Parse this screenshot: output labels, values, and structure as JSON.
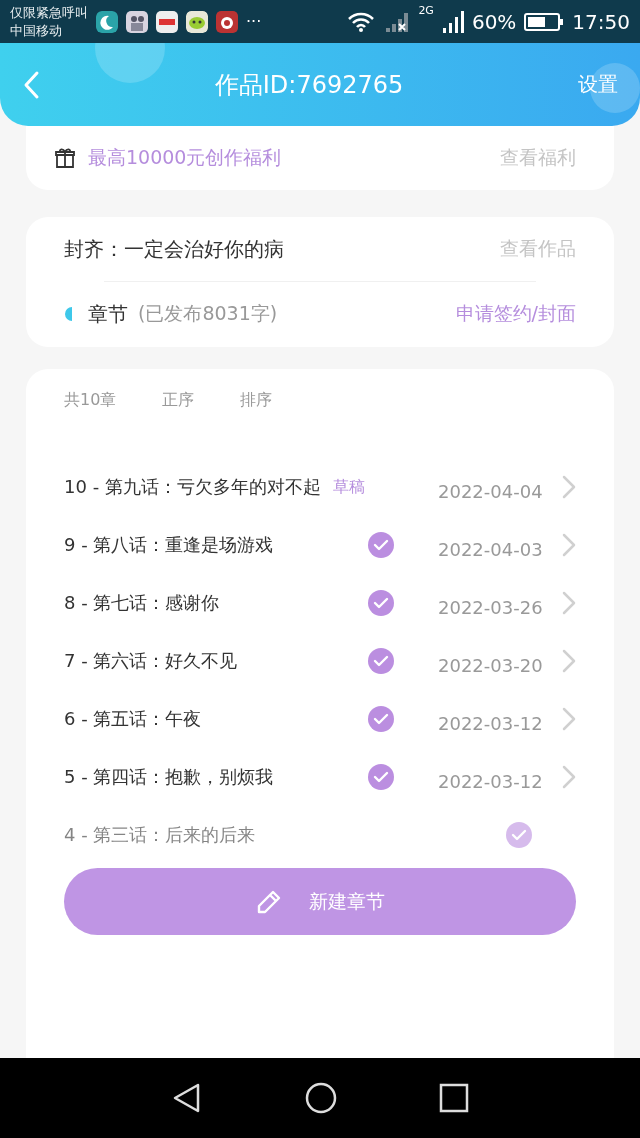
{
  "status_bar": {
    "carrier_notice": "仅限紧急呼叫",
    "carrier": "中国移动",
    "more": "···",
    "network": "2G",
    "battery": "60%",
    "time": "17:50"
  },
  "header": {
    "title": "作品ID:7692765",
    "action": "设置"
  },
  "benefit": {
    "text": "最高10000元创作福利",
    "link": "查看福利"
  },
  "work": {
    "title": "封齐：一定会治好你的病",
    "view": "查看作品",
    "section": "章节",
    "published": "(已发布8031字)",
    "apply": "申请签约/封面"
  },
  "chapters": {
    "count": "共10章",
    "tabs": [
      {
        "label": "正序",
        "selected": false
      },
      {
        "label": "排序",
        "selected": false
      }
    ],
    "rows": [
      {
        "title": "10 - 第九话：亏欠多年的对不起",
        "kind": "draft",
        "badge": "草稿",
        "date": "2022-04-04"
      },
      {
        "title": "9 - 第八话：重逢是场游戏",
        "kind": "published",
        "date": "2022-04-03"
      },
      {
        "title": "8 - 第七话：感谢你",
        "kind": "published",
        "date": "2022-03-26"
      },
      {
        "title": "7 - 第六话：好久不见",
        "kind": "published",
        "date": "2022-03-20"
      },
      {
        "title": "6 - 第五话：午夜",
        "kind": "published",
        "date": "2022-03-12"
      },
      {
        "title": "5 - 第四话：抱歉，别烦我",
        "kind": "published",
        "date": "2022-03-12"
      },
      {
        "title": "4 - 第三话：后来的后来",
        "kind": "published"
      }
    ]
  },
  "new_button": "新建章节"
}
